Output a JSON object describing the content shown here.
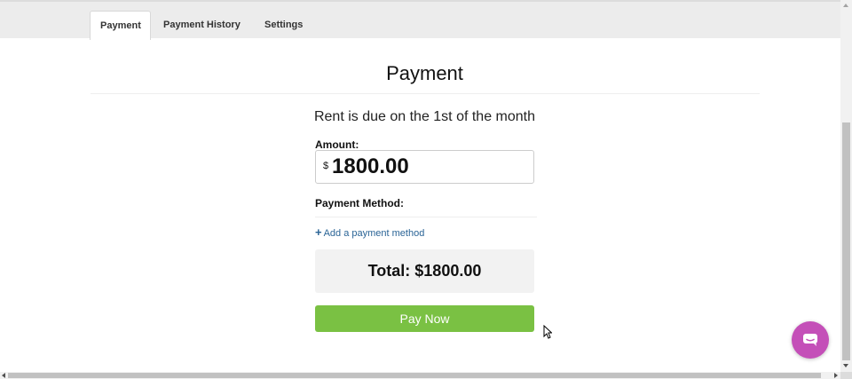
{
  "tabs": [
    {
      "label": "Payment",
      "active": true
    },
    {
      "label": "Payment History",
      "active": false
    },
    {
      "label": "Settings",
      "active": false
    }
  ],
  "page": {
    "title": "Payment",
    "subtitle": "Rent is due on the 1st of the month"
  },
  "form": {
    "amount_label": "Amount:",
    "currency_symbol": "$",
    "amount_value": "1800.00",
    "method_label": "Payment Method:",
    "add_method_icon": "+",
    "add_method_label": "Add a payment method",
    "total_text": "Total: $1800.00",
    "pay_button_label": "Pay Now"
  },
  "colors": {
    "pay_button": "#7ac143",
    "link": "#2a6496",
    "chat_button": "#c44fb8",
    "total_background": "#f2f2f2"
  },
  "icons": {
    "add": "plus-icon",
    "chat": "chat-bubble-icon",
    "cursor": "mouse-pointer-icon"
  }
}
